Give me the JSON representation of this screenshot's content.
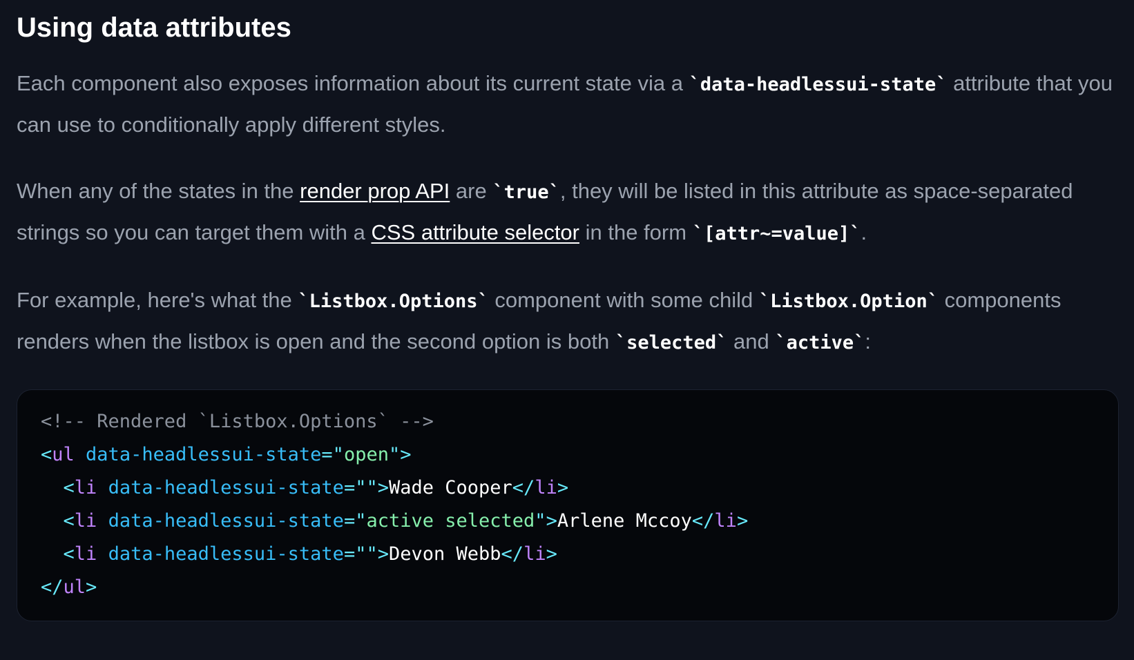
{
  "heading": "Using data attributes",
  "para1": {
    "t1": "Each component also exposes information about its current state via a ",
    "code1": "`data-headlessui-state`",
    "t2": " attribute that you can use to conditionally apply different styles."
  },
  "para2": {
    "t1": "When any of the states in the ",
    "link1": "render prop API",
    "t2": " are ",
    "code1": "`true`",
    "t3": ", they will be listed in this attribute as space-separated strings so you can target them with a ",
    "link2": "CSS attribute selector",
    "t4": " in the form ",
    "code2": "`[attr~=value]`",
    "t5": "."
  },
  "para3": {
    "t1": "For example, here's what the ",
    "code1": "`Listbox.Options`",
    "t2": " component with some child ",
    "code2": "`Listbox.Option`",
    "t3": " components renders when the listbox is open and the second option is both ",
    "code3": "`selected`",
    "t4": " and ",
    "code4": "`active`",
    "t5": ":"
  },
  "code": {
    "comment": "<!-- Rendered `Listbox.Options` -->",
    "lt": "<",
    "gt": ">",
    "close_lt": "</",
    "eq_quote": "=\"",
    "quote": "\"",
    "indent": "  ",
    "ul_tag": "ul",
    "li_tag": "li",
    "attr": "data-headlessui-state",
    "ul_state": "open",
    "item1_state": "",
    "item2_state": "active selected",
    "item3_state": "",
    "items": [
      "Wade Cooper",
      "Arlene Mccoy",
      "Devon Webb"
    ]
  },
  "colors": {
    "background": "#0f131d",
    "code_background": "#05070b",
    "body_text": "#9ca3af",
    "heading": "#ffffff",
    "punctuation": "#67e8f9",
    "tag": "#c084fc",
    "attribute": "#38bdf8",
    "string": "#86efac",
    "comment": "#8b919c"
  }
}
